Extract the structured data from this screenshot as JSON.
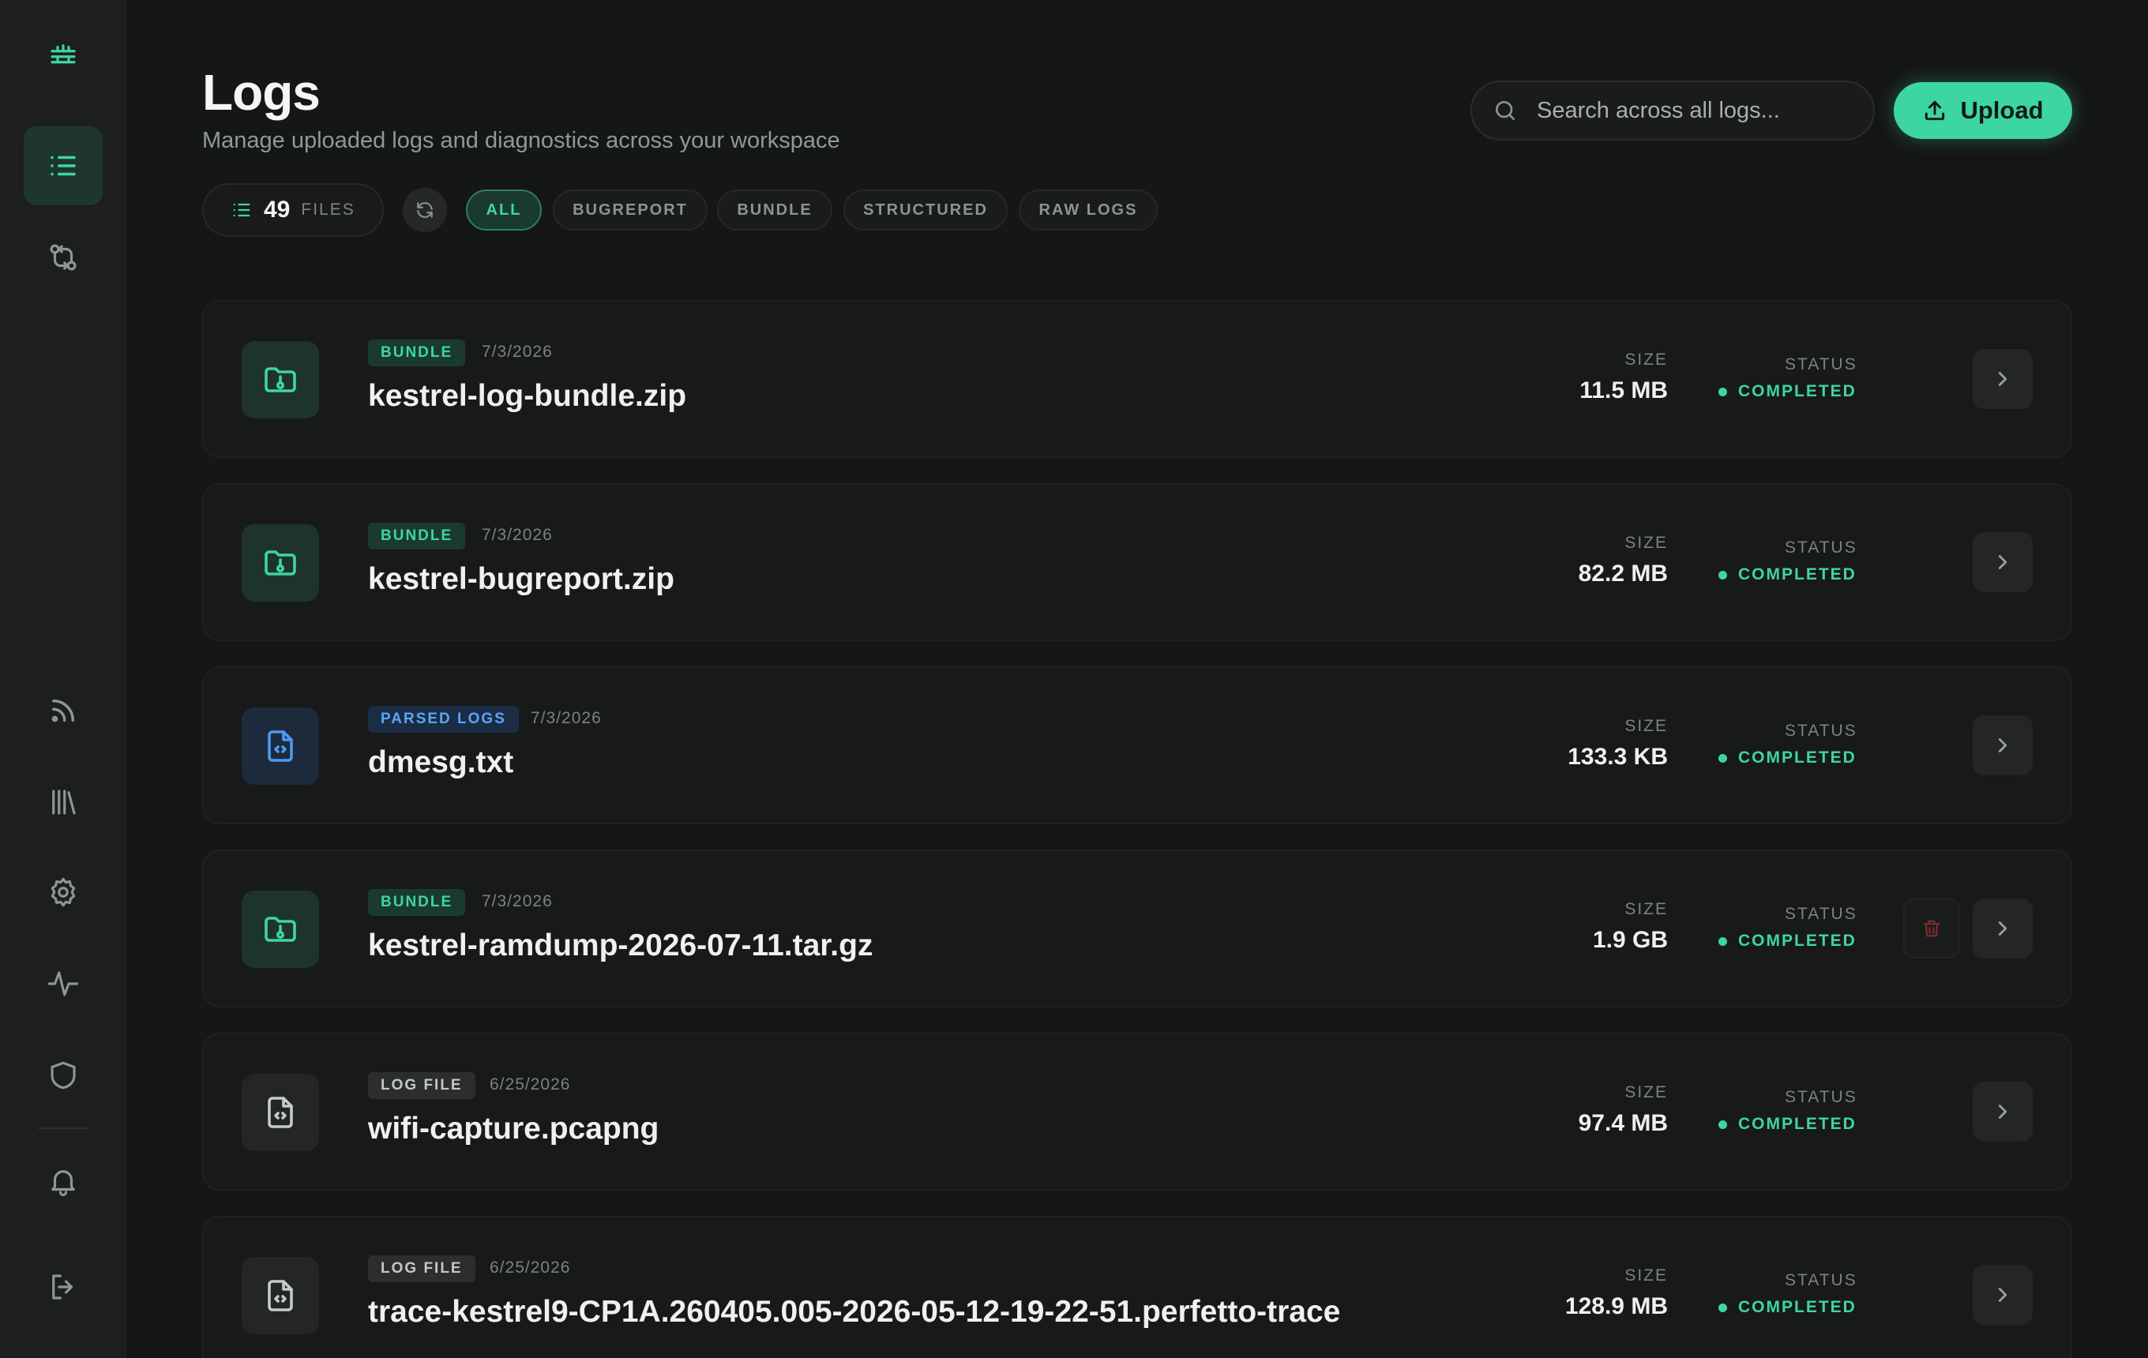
{
  "sidebar": {
    "items": [
      {
        "name": "logo",
        "icon": "layers-logo-icon"
      },
      {
        "name": "logs",
        "icon": "list-icon",
        "active": true
      },
      {
        "name": "compare",
        "icon": "git-compare-icon"
      },
      {
        "name": "feeds",
        "icon": "rss-icon"
      },
      {
        "name": "library",
        "icon": "library-icon"
      },
      {
        "name": "settings",
        "icon": "gear-icon"
      },
      {
        "name": "activity",
        "icon": "activity-icon"
      },
      {
        "name": "security",
        "icon": "shield-icon"
      },
      {
        "name": "notifications",
        "icon": "bell-icon"
      },
      {
        "name": "logout",
        "icon": "logout-icon"
      }
    ]
  },
  "header": {
    "title": "Logs",
    "subtitle": "Manage uploaded logs and diagnostics across your workspace",
    "search_placeholder": "Search across all logs...",
    "upload_label": "Upload"
  },
  "filters": {
    "file_count": "49",
    "file_label": "FILES",
    "chips": [
      "ALL",
      "BUGREPORT",
      "BUNDLE",
      "STRUCTURED",
      "RAW LOGS"
    ],
    "active_chip": "ALL"
  },
  "labels": {
    "size": "SIZE",
    "status": "STATUS"
  },
  "colors": {
    "accent": "#3dd6a0",
    "background": "#151616",
    "sidebar": "#1d1e1e",
    "parsed_blue": "#4a9bf0",
    "delete_red": "#7a2f30"
  },
  "rows": [
    {
      "badge": "BUNDLE",
      "badge_style": "green",
      "date": "7/3/2026",
      "name": "kestrel-log-bundle.zip",
      "size": "11.5 MB",
      "status": "COMPLETED",
      "icon": "folder-icon"
    },
    {
      "badge": "BUNDLE",
      "badge_style": "green",
      "date": "7/3/2026",
      "name": "kestrel-bugreport.zip",
      "size": "82.2 MB",
      "status": "COMPLETED",
      "icon": "folder-icon"
    },
    {
      "badge": "PARSED LOGS",
      "badge_style": "blue",
      "date": "7/3/2026",
      "name": "dmesg.txt",
      "size": "133.3 KB",
      "status": "COMPLETED",
      "icon": "code-file-icon"
    },
    {
      "badge": "BUNDLE",
      "badge_style": "green",
      "date": "7/3/2026",
      "name": "kestrel-ramdump-2026-07-11.tar.gz",
      "size": "1.9 GB",
      "status": "COMPLETED",
      "icon": "folder-icon",
      "deletable": true
    },
    {
      "badge": "LOG FILE",
      "badge_style": "gray",
      "date": "6/25/2026",
      "name": "wifi-capture.pcapng",
      "size": "97.4 MB",
      "status": "COMPLETED",
      "icon": "code-file-icon"
    },
    {
      "badge": "LOG FILE",
      "badge_style": "gray",
      "date": "6/25/2026",
      "name": "trace-kestrel9-CP1A.260405.005-2026-05-12-19-22-51.perfetto-trace",
      "size": "128.9 MB",
      "status": "COMPLETED",
      "icon": "code-file-icon"
    }
  ]
}
